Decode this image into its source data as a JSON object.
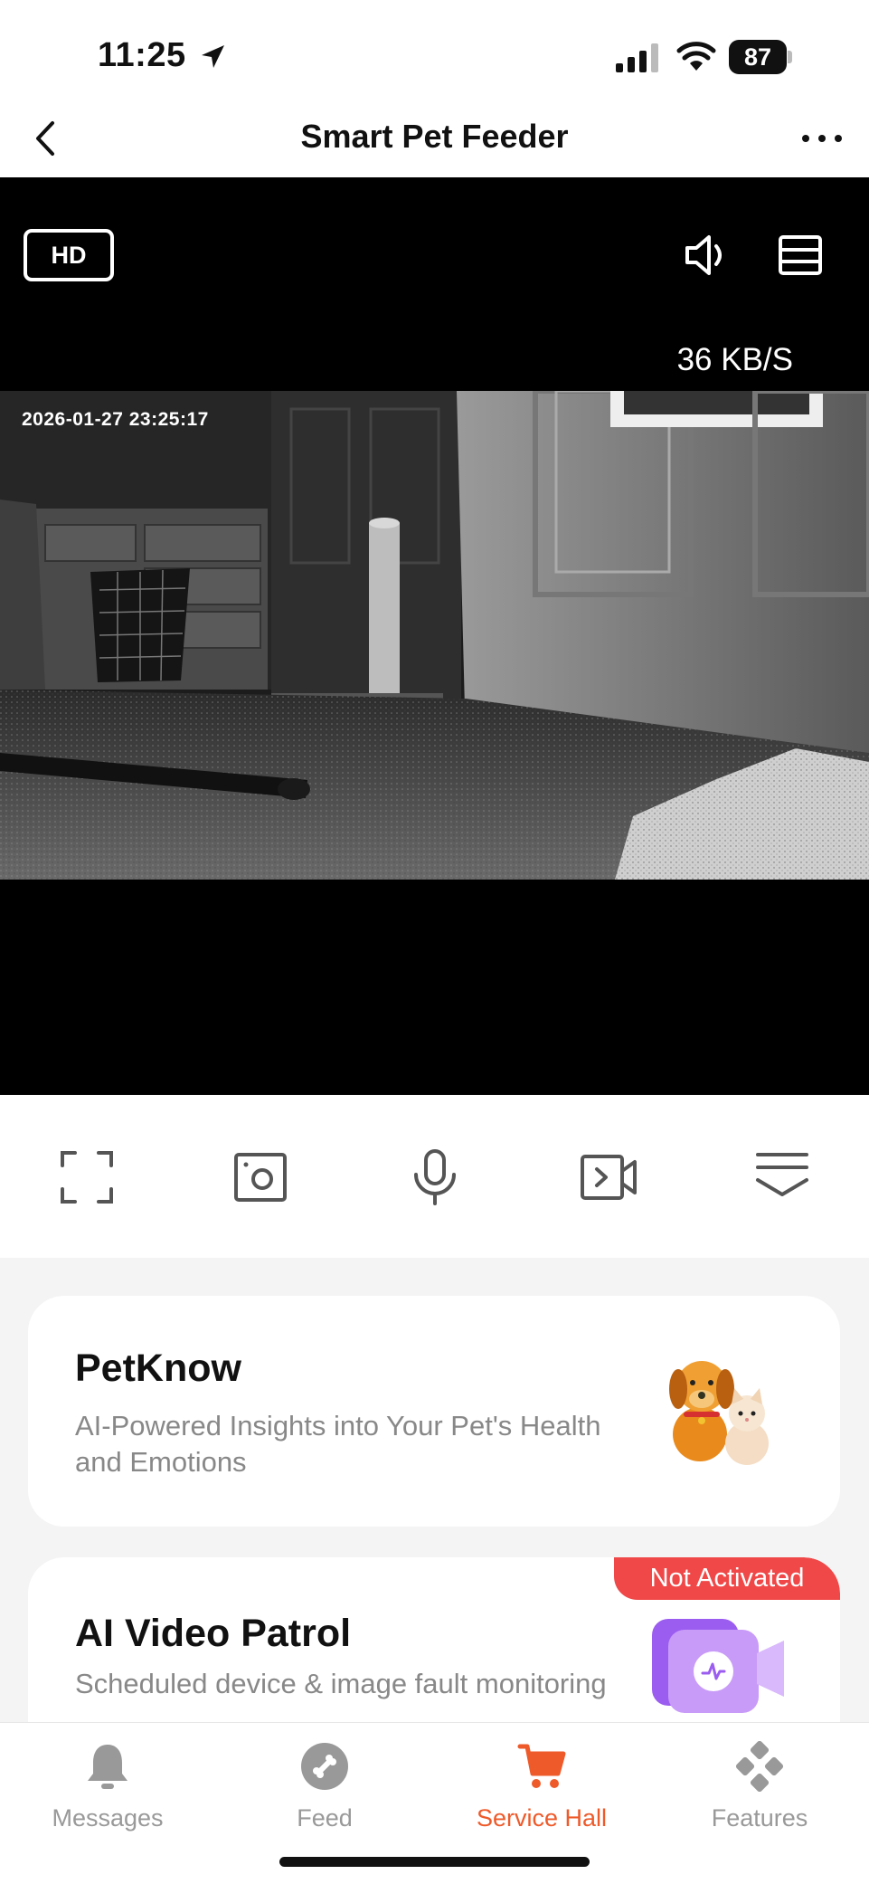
{
  "status_bar": {
    "time": "11:25",
    "battery": "87"
  },
  "header": {
    "title": "Smart Pet Feeder"
  },
  "video": {
    "quality": "HD",
    "speed": "36 KB/S",
    "timestamp": "2026-01-27  23:25:17"
  },
  "controls": [
    "fullscreen-icon",
    "screenshot-icon",
    "microphone-icon",
    "record-video-icon",
    "collapse-icon"
  ],
  "cards": {
    "petknow": {
      "title": "PetKnow",
      "description": "AI-Powered Insights into Your Pet's Health and Emotions"
    },
    "patrol": {
      "title": "AI Video Patrol",
      "description": "Scheduled device & image fault monitoring",
      "badge": "Not Activated"
    }
  },
  "tabs": {
    "messages": "Messages",
    "feed": "Feed",
    "service_hall": "Service Hall",
    "features": "Features"
  },
  "colors": {
    "accent": "#ee5a2a",
    "badge": "#f04848",
    "inactive": "#999999"
  }
}
